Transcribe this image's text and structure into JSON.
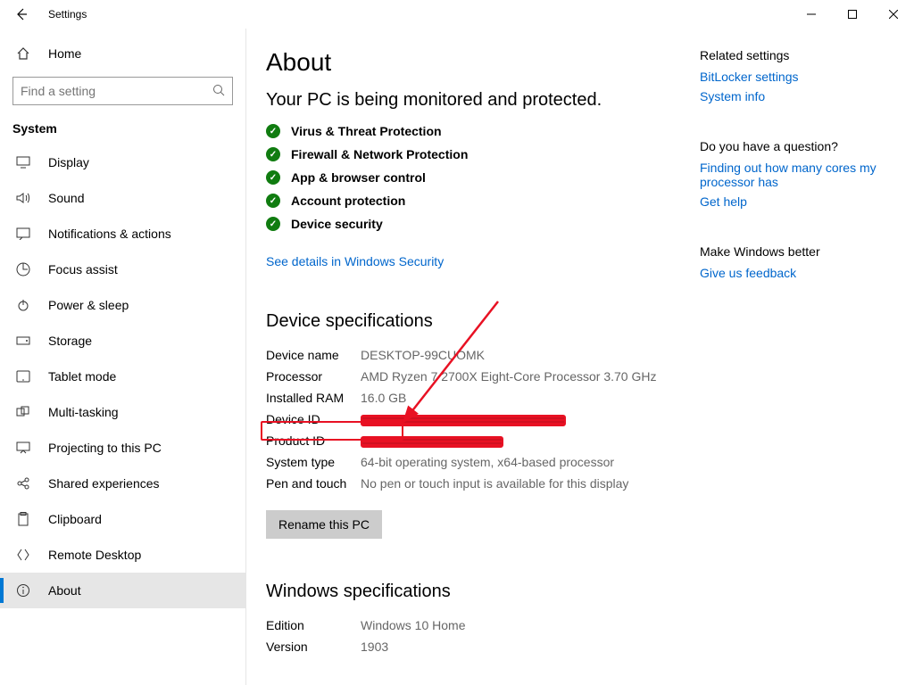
{
  "window": {
    "title": "Settings"
  },
  "sidebar": {
    "home": "Home",
    "search_placeholder": "Find a setting",
    "section": "System",
    "items": [
      {
        "label": "Display",
        "icon": "display-icon"
      },
      {
        "label": "Sound",
        "icon": "sound-icon"
      },
      {
        "label": "Notifications & actions",
        "icon": "notifications-icon"
      },
      {
        "label": "Focus assist",
        "icon": "focus-assist-icon"
      },
      {
        "label": "Power & sleep",
        "icon": "power-icon"
      },
      {
        "label": "Storage",
        "icon": "storage-icon"
      },
      {
        "label": "Tablet mode",
        "icon": "tablet-icon"
      },
      {
        "label": "Multi-tasking",
        "icon": "multitasking-icon"
      },
      {
        "label": "Projecting to this PC",
        "icon": "projecting-icon"
      },
      {
        "label": "Shared experiences",
        "icon": "shared-icon"
      },
      {
        "label": "Clipboard",
        "icon": "clipboard-icon"
      },
      {
        "label": "Remote Desktop",
        "icon": "remote-icon"
      },
      {
        "label": "About",
        "icon": "about-icon"
      }
    ]
  },
  "page": {
    "title": "About",
    "monitor_heading": "Your PC is being monitored and protected.",
    "protections": [
      "Virus & Threat Protection",
      "Firewall & Network Protection",
      "App & browser control",
      "Account protection",
      "Device security"
    ],
    "security_link": "See details in Windows Security",
    "device_spec_heading": "Device specifications",
    "specs": {
      "device_name": {
        "label": "Device name",
        "value": "DESKTOP-99CUOMK"
      },
      "processor": {
        "label": "Processor",
        "value": "AMD Ryzen 7 2700X Eight-Core Processor 3.70 GHz"
      },
      "ram": {
        "label": "Installed RAM",
        "value": "16.0 GB"
      },
      "device_id": {
        "label": "Device ID",
        "value": ""
      },
      "product_id": {
        "label": "Product ID",
        "value": ""
      },
      "system_type": {
        "label": "System type",
        "value": "64-bit operating system, x64-based processor"
      },
      "pen_touch": {
        "label": "Pen and touch",
        "value": "No pen or touch input is available for this display"
      }
    },
    "rename_button": "Rename this PC",
    "win_spec_heading": "Windows specifications",
    "win_specs": {
      "edition": {
        "label": "Edition",
        "value": "Windows 10 Home"
      },
      "version": {
        "label": "Version",
        "value": "1903"
      }
    }
  },
  "aside": {
    "related_heading": "Related settings",
    "related_links": [
      "BitLocker settings",
      "System info"
    ],
    "question_heading": "Do you have a question?",
    "question_links": [
      "Finding out how many cores my processor has",
      "Get help"
    ],
    "better_heading": "Make Windows better",
    "better_links": [
      "Give us feedback"
    ]
  },
  "annotation": {
    "highlight_label": "Installed RAM",
    "highlight_value": "16.0 GB"
  }
}
